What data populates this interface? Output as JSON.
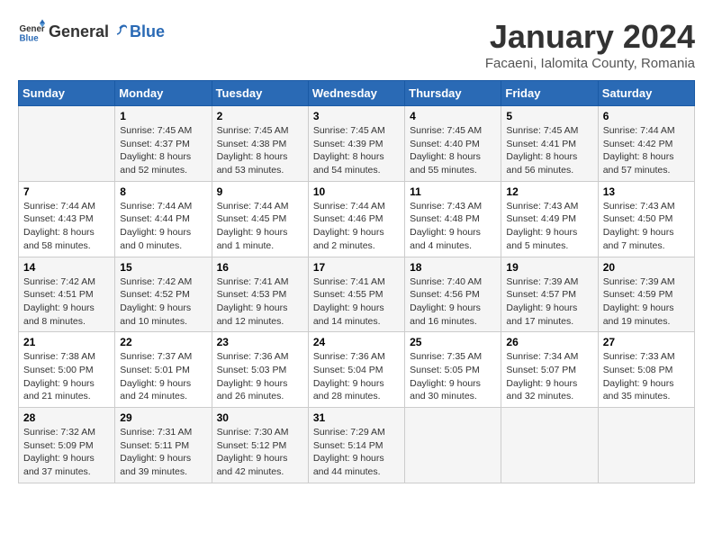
{
  "header": {
    "logo_general": "General",
    "logo_blue": "Blue",
    "month_year": "January 2024",
    "location": "Facaeni, Ialomita County, Romania"
  },
  "weekdays": [
    "Sunday",
    "Monday",
    "Tuesday",
    "Wednesday",
    "Thursday",
    "Friday",
    "Saturday"
  ],
  "weeks": [
    [
      {
        "day": "",
        "info": ""
      },
      {
        "day": "1",
        "info": "Sunrise: 7:45 AM\nSunset: 4:37 PM\nDaylight: 8 hours\nand 52 minutes."
      },
      {
        "day": "2",
        "info": "Sunrise: 7:45 AM\nSunset: 4:38 PM\nDaylight: 8 hours\nand 53 minutes."
      },
      {
        "day": "3",
        "info": "Sunrise: 7:45 AM\nSunset: 4:39 PM\nDaylight: 8 hours\nand 54 minutes."
      },
      {
        "day": "4",
        "info": "Sunrise: 7:45 AM\nSunset: 4:40 PM\nDaylight: 8 hours\nand 55 minutes."
      },
      {
        "day": "5",
        "info": "Sunrise: 7:45 AM\nSunset: 4:41 PM\nDaylight: 8 hours\nand 56 minutes."
      },
      {
        "day": "6",
        "info": "Sunrise: 7:44 AM\nSunset: 4:42 PM\nDaylight: 8 hours\nand 57 minutes."
      }
    ],
    [
      {
        "day": "7",
        "info": "Sunrise: 7:44 AM\nSunset: 4:43 PM\nDaylight: 8 hours\nand 58 minutes."
      },
      {
        "day": "8",
        "info": "Sunrise: 7:44 AM\nSunset: 4:44 PM\nDaylight: 9 hours\nand 0 minutes."
      },
      {
        "day": "9",
        "info": "Sunrise: 7:44 AM\nSunset: 4:45 PM\nDaylight: 9 hours\nand 1 minute."
      },
      {
        "day": "10",
        "info": "Sunrise: 7:44 AM\nSunset: 4:46 PM\nDaylight: 9 hours\nand 2 minutes."
      },
      {
        "day": "11",
        "info": "Sunrise: 7:43 AM\nSunset: 4:48 PM\nDaylight: 9 hours\nand 4 minutes."
      },
      {
        "day": "12",
        "info": "Sunrise: 7:43 AM\nSunset: 4:49 PM\nDaylight: 9 hours\nand 5 minutes."
      },
      {
        "day": "13",
        "info": "Sunrise: 7:43 AM\nSunset: 4:50 PM\nDaylight: 9 hours\nand 7 minutes."
      }
    ],
    [
      {
        "day": "14",
        "info": "Sunrise: 7:42 AM\nSunset: 4:51 PM\nDaylight: 9 hours\nand 8 minutes."
      },
      {
        "day": "15",
        "info": "Sunrise: 7:42 AM\nSunset: 4:52 PM\nDaylight: 9 hours\nand 10 minutes."
      },
      {
        "day": "16",
        "info": "Sunrise: 7:41 AM\nSunset: 4:53 PM\nDaylight: 9 hours\nand 12 minutes."
      },
      {
        "day": "17",
        "info": "Sunrise: 7:41 AM\nSunset: 4:55 PM\nDaylight: 9 hours\nand 14 minutes."
      },
      {
        "day": "18",
        "info": "Sunrise: 7:40 AM\nSunset: 4:56 PM\nDaylight: 9 hours\nand 16 minutes."
      },
      {
        "day": "19",
        "info": "Sunrise: 7:39 AM\nSunset: 4:57 PM\nDaylight: 9 hours\nand 17 minutes."
      },
      {
        "day": "20",
        "info": "Sunrise: 7:39 AM\nSunset: 4:59 PM\nDaylight: 9 hours\nand 19 minutes."
      }
    ],
    [
      {
        "day": "21",
        "info": "Sunrise: 7:38 AM\nSunset: 5:00 PM\nDaylight: 9 hours\nand 21 minutes."
      },
      {
        "day": "22",
        "info": "Sunrise: 7:37 AM\nSunset: 5:01 PM\nDaylight: 9 hours\nand 24 minutes."
      },
      {
        "day": "23",
        "info": "Sunrise: 7:36 AM\nSunset: 5:03 PM\nDaylight: 9 hours\nand 26 minutes."
      },
      {
        "day": "24",
        "info": "Sunrise: 7:36 AM\nSunset: 5:04 PM\nDaylight: 9 hours\nand 28 minutes."
      },
      {
        "day": "25",
        "info": "Sunrise: 7:35 AM\nSunset: 5:05 PM\nDaylight: 9 hours\nand 30 minutes."
      },
      {
        "day": "26",
        "info": "Sunrise: 7:34 AM\nSunset: 5:07 PM\nDaylight: 9 hours\nand 32 minutes."
      },
      {
        "day": "27",
        "info": "Sunrise: 7:33 AM\nSunset: 5:08 PM\nDaylight: 9 hours\nand 35 minutes."
      }
    ],
    [
      {
        "day": "28",
        "info": "Sunrise: 7:32 AM\nSunset: 5:09 PM\nDaylight: 9 hours\nand 37 minutes."
      },
      {
        "day": "29",
        "info": "Sunrise: 7:31 AM\nSunset: 5:11 PM\nDaylight: 9 hours\nand 39 minutes."
      },
      {
        "day": "30",
        "info": "Sunrise: 7:30 AM\nSunset: 5:12 PM\nDaylight: 9 hours\nand 42 minutes."
      },
      {
        "day": "31",
        "info": "Sunrise: 7:29 AM\nSunset: 5:14 PM\nDaylight: 9 hours\nand 44 minutes."
      },
      {
        "day": "",
        "info": ""
      },
      {
        "day": "",
        "info": ""
      },
      {
        "day": "",
        "info": ""
      }
    ]
  ]
}
